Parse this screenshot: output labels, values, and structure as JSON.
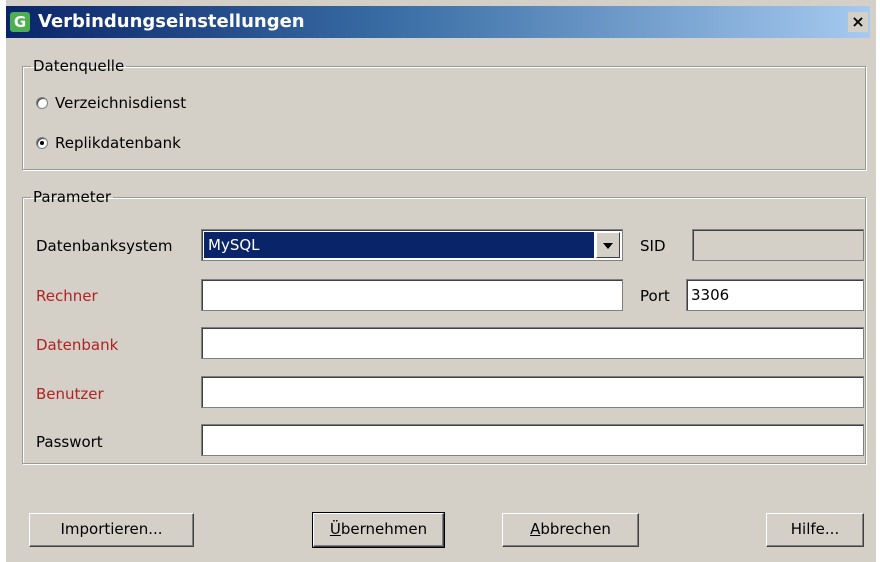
{
  "window": {
    "title": "Verbindungseinstellungen",
    "app_icon": "G",
    "close_symbol": "×"
  },
  "datasource": {
    "legend": "Datenquelle",
    "options": [
      {
        "label": "Verzeichnisdienst",
        "checked": false
      },
      {
        "label": "Replikdatenbank",
        "checked": true
      }
    ]
  },
  "parameters": {
    "legend": "Parameter",
    "dbsystem_label": "Datenbanksystem",
    "dbsystem_value": "MySQL",
    "sid_label": "SID",
    "sid_value": "",
    "host_label": "Rechner",
    "host_value": "",
    "port_label": "Port",
    "port_value": "3306",
    "database_label": "Datenbank",
    "database_value": "",
    "user_label": "Benutzer",
    "user_value": "",
    "password_label": "Passwort",
    "password_value": ""
  },
  "buttons": {
    "import": "Importieren...",
    "apply_mnemonic": "Ü",
    "apply_rest": "bernehmen",
    "cancel_mnemonic": "A",
    "cancel_rest": "bbrechen",
    "help": "Hilfe..."
  },
  "colors": {
    "titlebar_start": "#0a246a",
    "required_label": "#b22222",
    "selection": "#0a246a"
  }
}
